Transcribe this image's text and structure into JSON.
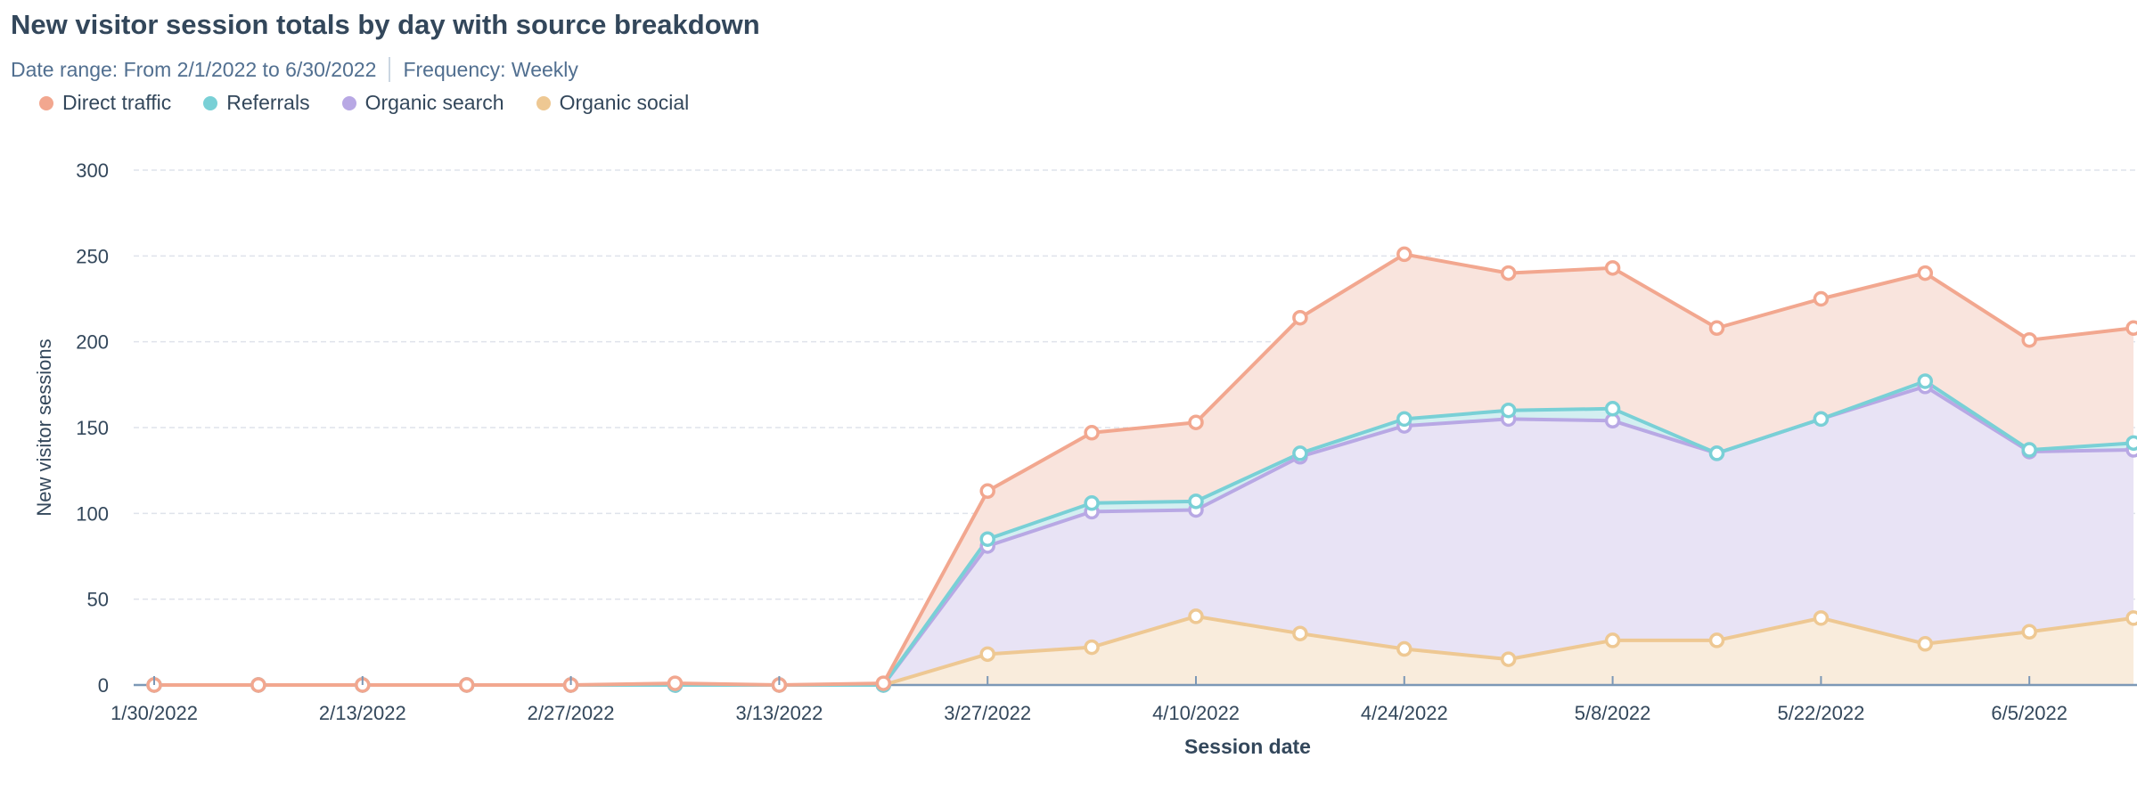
{
  "chart_data": {
    "type": "area",
    "stacked": true,
    "title": "New visitor session totals by day with source breakdown",
    "subtitle": {
      "date_range": "Date range: From 2/1/2022 to 6/30/2022",
      "frequency": "Frequency: Weekly"
    },
    "xlabel": "Session date",
    "ylabel": "New visitor sessions",
    "ylim": [
      0,
      300
    ],
    "yticks": [
      "0",
      "50",
      "100",
      "150",
      "200",
      "250",
      "300"
    ],
    "xtick_labels": [
      "1/30/2022",
      "2/13/2022",
      "2/27/2022",
      "3/13/2022",
      "3/27/2022",
      "4/10/2022",
      "4/24/2022",
      "5/8/2022",
      "5/22/2022",
      "6/5/2022"
    ],
    "x": [
      "1/30/2022",
      "2/6/2022",
      "2/13/2022",
      "2/20/2022",
      "2/27/2022",
      "3/6/2022",
      "3/13/2022",
      "3/20/2022",
      "3/27/2022",
      "4/3/2022",
      "4/10/2022",
      "4/17/2022",
      "4/24/2022",
      "5/1/2022",
      "5/8/2022",
      "5/15/2022",
      "5/22/2022",
      "5/29/2022",
      "6/5/2022",
      "6/12/2022"
    ],
    "grid": true,
    "legend_position": "top-left",
    "series": [
      {
        "name": "Organic social",
        "color": "#eec893",
        "fill": "#f9ecdc",
        "values": [
          0,
          0,
          0,
          0,
          0,
          0,
          0,
          0,
          18,
          22,
          40,
          30,
          21,
          15,
          26,
          26,
          39,
          24,
          31,
          39
        ]
      },
      {
        "name": "Organic search",
        "color": "#b8a8e4",
        "fill": "#e8e3f5",
        "values": [
          0,
          0,
          0,
          0,
          0,
          0,
          0,
          0,
          63,
          79,
          62,
          103,
          130,
          140,
          128,
          109,
          116,
          150,
          105,
          98
        ]
      },
      {
        "name": "Referrals",
        "color": "#79d0d6",
        "fill": "#d3eff1",
        "values": [
          0,
          0,
          0,
          0,
          0,
          0,
          0,
          0,
          4,
          5,
          5,
          2,
          4,
          5,
          7,
          0,
          0,
          3,
          1,
          4
        ]
      },
      {
        "name": "Direct traffic",
        "color": "#f2a78f",
        "fill": "#f9e4dd",
        "values": [
          0,
          0,
          0,
          0,
          0,
          1,
          0,
          1,
          28,
          41,
          46,
          79,
          96,
          80,
          82,
          73,
          70,
          63,
          64,
          67
        ]
      }
    ],
    "legend_order": [
      "Direct traffic",
      "Referrals",
      "Organic search",
      "Organic social"
    ]
  }
}
